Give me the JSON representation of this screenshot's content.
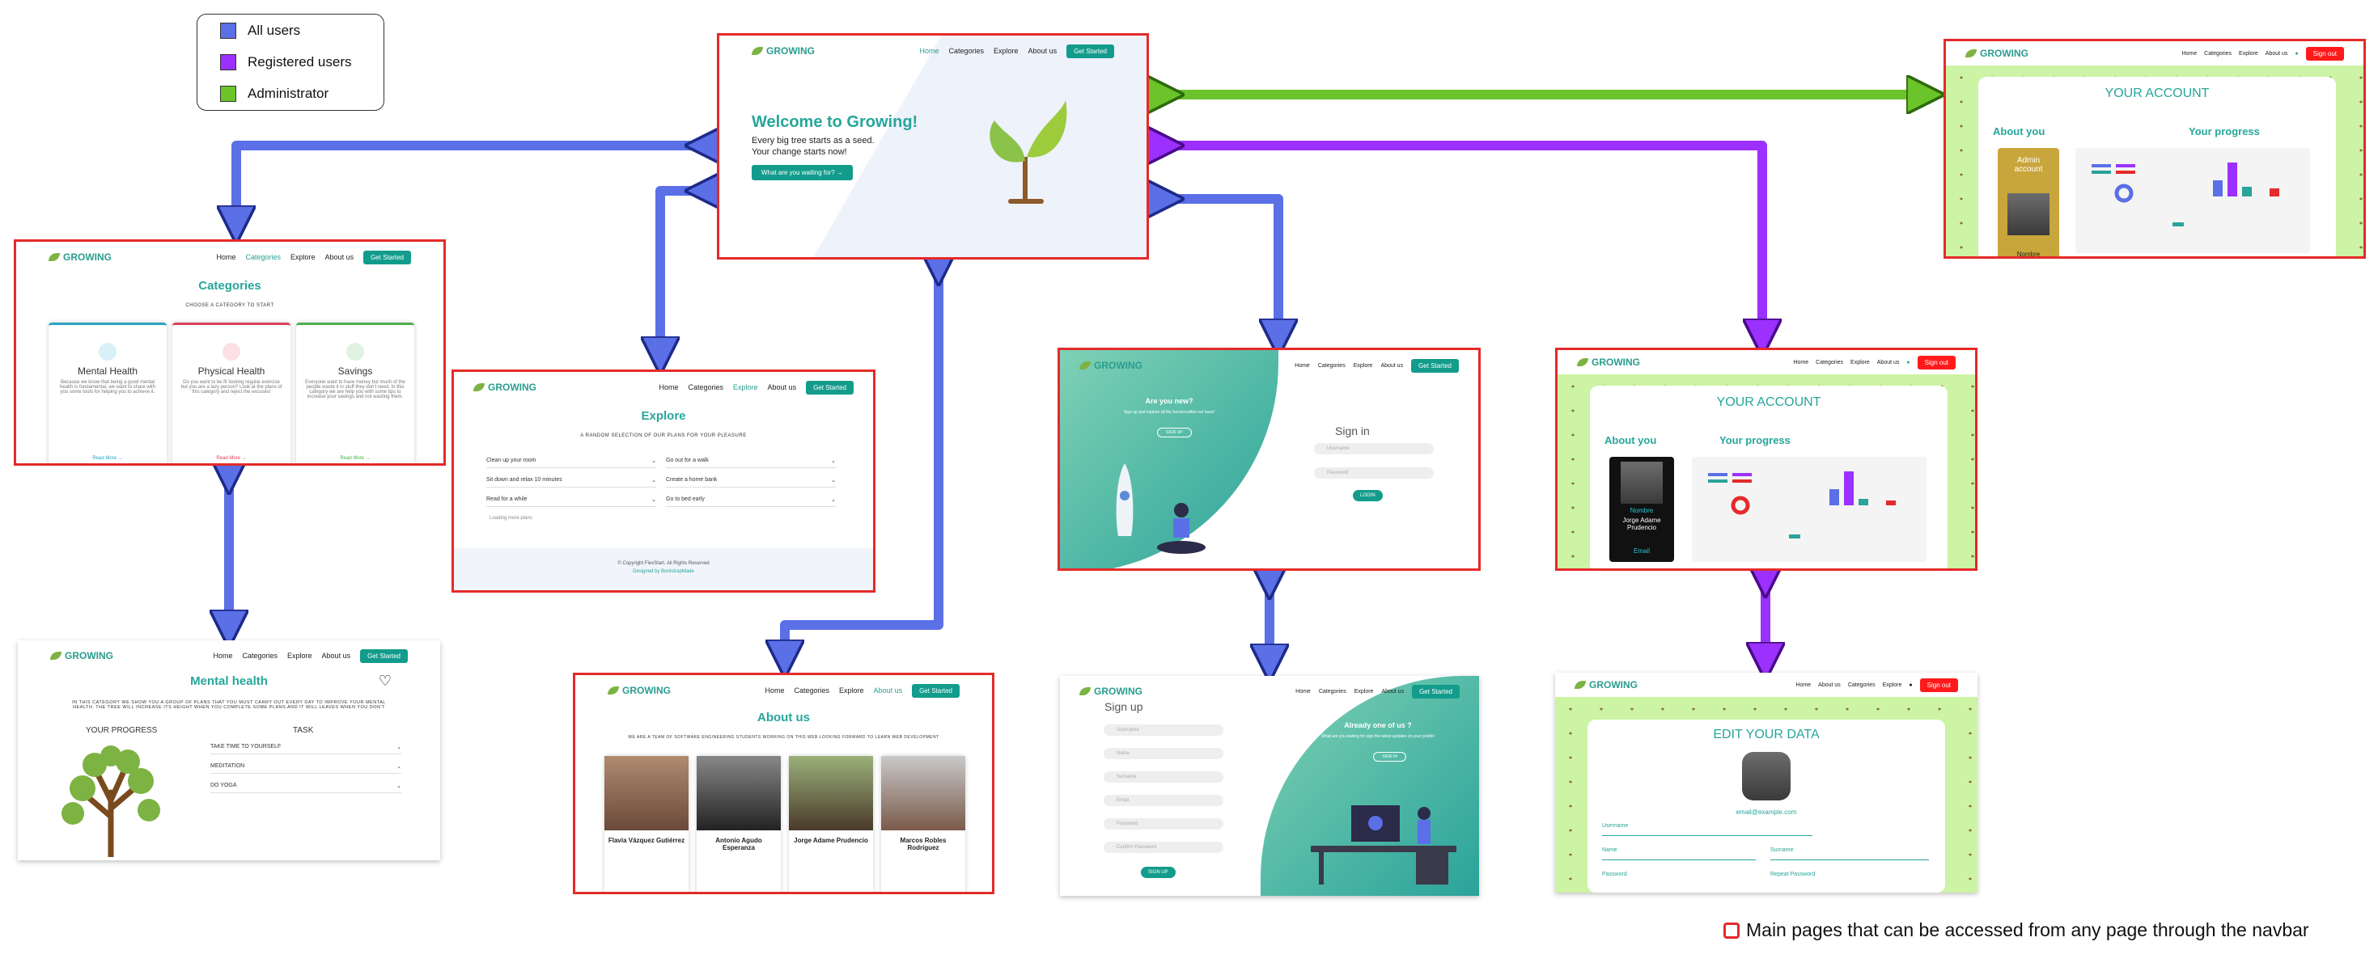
{
  "legend": {
    "items": [
      {
        "label": "All users",
        "color": "#5b6fe6"
      },
      {
        "label": "Registered users",
        "color": "#9b30ff"
      },
      {
        "label": "Administrator",
        "color": "#6ac42a"
      }
    ]
  },
  "footer_note": "Main pages that can be accessed from any page through the navbar",
  "colors": {
    "main_border": "#e52a2a",
    "teal": "#26a69a",
    "blue_arrow": "#5b6fe6",
    "purple_arrow": "#9b30ff",
    "green_arrow": "#6ac42a"
  },
  "brand": "GROWING",
  "nav": {
    "home": "Home",
    "categories": "Categories",
    "explore": "Explore",
    "about": "About us",
    "get_started": "Get Started",
    "sign_out": "Sign out"
  },
  "home": {
    "title": "Welcome to Growing!",
    "line1": "Every big tree starts as a seed.",
    "line2": "Your change starts now!",
    "cta": "What are you waiting for? →"
  },
  "categories": {
    "title": "Categories",
    "subtitle": "CHOOSE A CATEGORY TO START",
    "cards": [
      {
        "name": "Mental Health",
        "text": "Because we know that being a good mental health is fundamental, we want to share with you some tools for helping you to achieve it.",
        "link": "Read More →",
        "color": "#2aa3c4"
      },
      {
        "name": "Physical Health",
        "text": "Do you want to be fit looking regular exercise but you are a lazy person? Look at the plans of this category and reject the excuses!",
        "link": "Read More →",
        "color": "#e0405a"
      },
      {
        "name": "Savings",
        "text": "Everyone want to have money but much of the people waste it in stuff they don't need. In this category we are help you with some tips to increase your savings and not wasting them.",
        "link": "Read More →",
        "color": "#4caf50"
      }
    ]
  },
  "explore": {
    "title": "Explore",
    "subtitle": "A RANDOM SELECTION OF OUR PLANS FOR YOUR PLEASURE",
    "items": [
      "Clean up your room",
      "Go out for a walk",
      "Sit down and relax 10 minutes",
      "Create a home bank",
      "Read for a while",
      "Go to bed early"
    ],
    "loading": "Loading more plans",
    "copyright": "© Copyright FlexStart. All Rights Reserved",
    "designed": "Designed by BootstrapMade"
  },
  "mental": {
    "title": "Mental health",
    "subtitle": "IN THIS CATEGORY WE SHOW YOU A GROUP OF PLANS THAT YOU MUST CARRY OUT EVERY DAY TO IMPROVE YOUR MENTAL HEALTH. THE TREE WILL INCREASE ITS HEIGHT WHEN YOU COMPLETE SOME PLANS AND IT WILL LEAVES WHEN YOU DON'T",
    "progress_label": "YOUR PROGRESS",
    "task_label": "TASK",
    "tasks": [
      "TAKE TIME TO YOURSELF",
      "MEDITATION",
      "DO YOGA"
    ]
  },
  "about": {
    "title": "About us",
    "subtitle": "WE ARE A TEAM OF SOFTWARE ENGINEERING STUDENTS WORKING ON THIS WEB LOOKING FORWARD TO LEARN WEB DEVELOPMENT",
    "members": [
      {
        "name": "Flavia Vázquez Gutiérrez"
      },
      {
        "name": "Antonio Agudo Esperanza"
      },
      {
        "name": "Jorge Adame Prudencio"
      },
      {
        "name": "Marcos Robles Rodríguez"
      }
    ]
  },
  "signin": {
    "new_title": "Are you new?",
    "new_text": "Sign up and explore all the functionalities we have!",
    "signup_btn": "SIGN UP",
    "title": "Sign in",
    "username_ph": "Username",
    "password_ph": "Password",
    "login_btn": "LOGIN"
  },
  "signup": {
    "title": "Sign up",
    "fields": [
      "Username",
      "Name",
      "Surname",
      "Email",
      "Password",
      "Confirm Password"
    ],
    "btn": "SIGN UP",
    "already": "Already one of us ?",
    "already_text": "What are you waiting for sign the latest updates on your profile!",
    "signin_btn": "SIGN IN"
  },
  "account": {
    "title": "YOUR ACCOUNT",
    "about": "About you",
    "progress": "Your progress",
    "admin_label": "Admin account",
    "name_label": "Nombre",
    "user_name": "Jorge Adame Prudencio",
    "email_label": "Email"
  },
  "edit": {
    "title": "EDIT YOUR DATA",
    "email": "email@example.com",
    "fields": [
      "Username",
      "Name",
      "Surname",
      "Password",
      "Repeat Password"
    ]
  }
}
